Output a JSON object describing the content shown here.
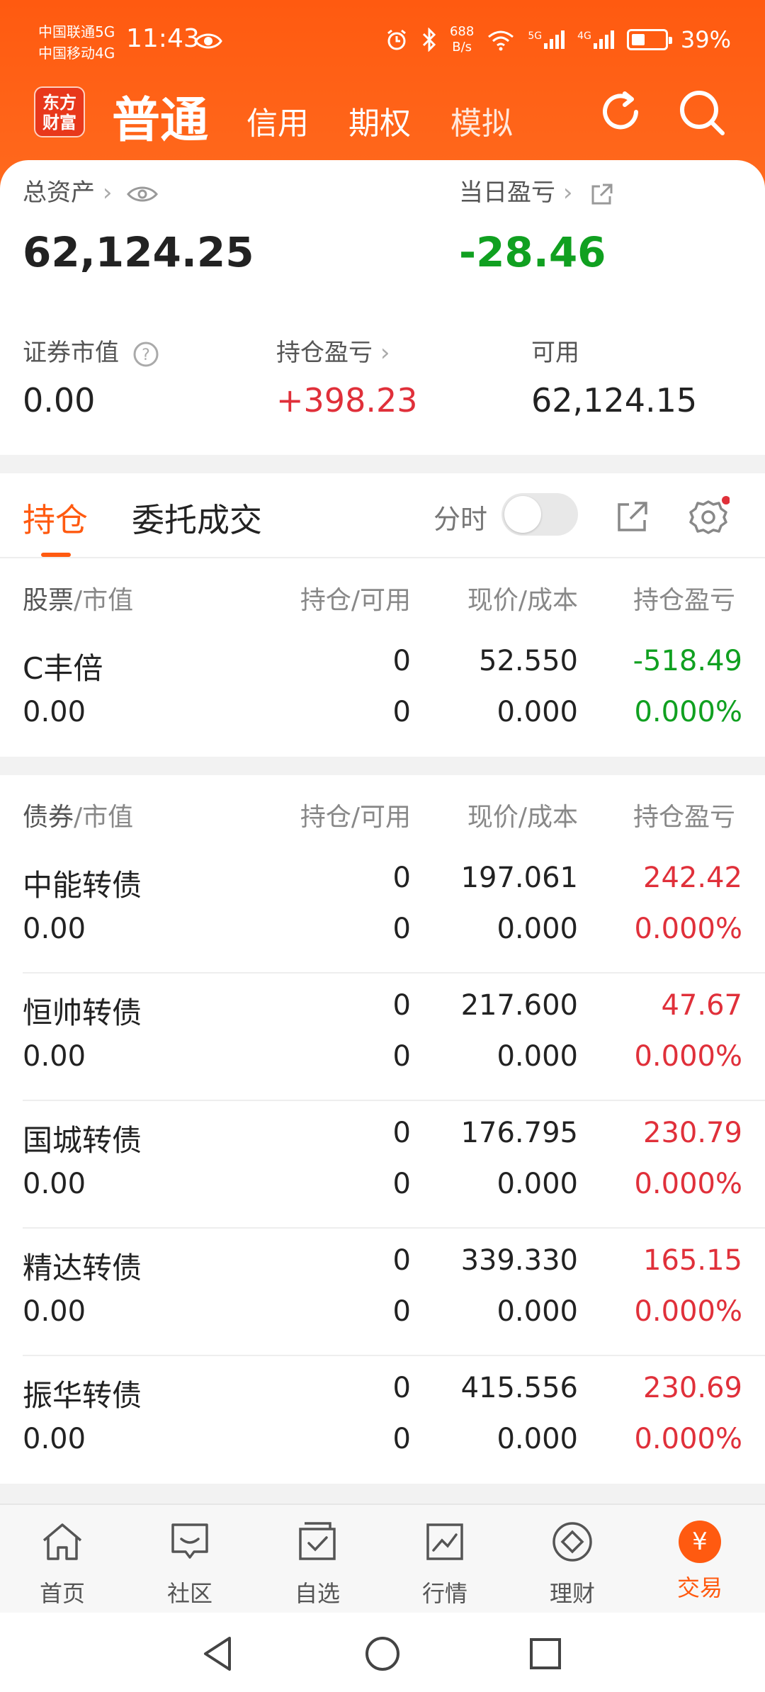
{
  "status_bar": {
    "carrier1": "中国联通5G",
    "carrier2": "中国移动4G",
    "time": "11:43",
    "net_speed_value": "688",
    "net_speed_unit": "B/s",
    "signal1": "5G",
    "signal2": "4G",
    "battery_text": "39%",
    "battery_level": 0.39
  },
  "app_bar": {
    "logo_line1": "东方",
    "logo_line2": "财富",
    "tab_normal": "普通",
    "tab_credit": "信用",
    "tab_options": "期权",
    "tab_simulate": "模拟"
  },
  "summary": {
    "total_assets_label": "总资产",
    "total_assets_value": "62,124.25",
    "daily_pl_label": "当日盈亏",
    "daily_pl_value": "-28.46",
    "securities_value_label": "证券市值",
    "securities_value": "0.00",
    "holding_pl_label": "持仓盈亏",
    "holding_pl_value": "+398.23",
    "available_label": "可用",
    "available_value": "62,124.15"
  },
  "tabs": {
    "positions": "持仓",
    "orders": "委托成交",
    "intraday": "分时"
  },
  "stocks": {
    "header": {
      "col1_main": "股票",
      "col1_sub": "/市值",
      "col2": "持仓/可用",
      "col3": "现价/成本",
      "col4": "持仓盈亏"
    },
    "rows": [
      {
        "name": "C丰倍",
        "market_value": "0.00",
        "position": "0",
        "available": "0",
        "price": "52.550",
        "cost": "0.000",
        "pl": "-518.49",
        "pl_pct": "0.000%"
      }
    ]
  },
  "bonds": {
    "header": {
      "col1_main": "债券",
      "col1_sub": "/市值",
      "col2": "持仓/可用",
      "col3": "现价/成本",
      "col4": "持仓盈亏"
    },
    "rows": [
      {
        "name": "中能转债",
        "market_value": "0.00",
        "position": "0",
        "available": "0",
        "price": "197.061",
        "cost": "0.000",
        "pl": "242.42",
        "pl_pct": "0.000%"
      },
      {
        "name": "恒帅转债",
        "market_value": "0.00",
        "position": "0",
        "available": "0",
        "price": "217.600",
        "cost": "0.000",
        "pl": "47.67",
        "pl_pct": "0.000%"
      },
      {
        "name": "国城转债",
        "market_value": "0.00",
        "position": "0",
        "available": "0",
        "price": "176.795",
        "cost": "0.000",
        "pl": "230.79",
        "pl_pct": "0.000%"
      },
      {
        "name": "精达转债",
        "market_value": "0.00",
        "position": "0",
        "available": "0",
        "price": "339.330",
        "cost": "0.000",
        "pl": "165.15",
        "pl_pct": "0.000%"
      },
      {
        "name": "振华转债",
        "market_value": "0.00",
        "position": "0",
        "available": "0",
        "price": "415.556",
        "cost": "0.000",
        "pl": "230.69",
        "pl_pct": "0.000%"
      }
    ]
  },
  "bottom_nav": {
    "home": "首页",
    "community": "社区",
    "watchlist": "自选",
    "market": "行情",
    "wealth": "理财",
    "trade": "交易",
    "trade_icon_glyph": "¥"
  },
  "colors": {
    "brand_orange": "#ff5a10",
    "up_red": "#e0303a",
    "down_green": "#10a020"
  }
}
